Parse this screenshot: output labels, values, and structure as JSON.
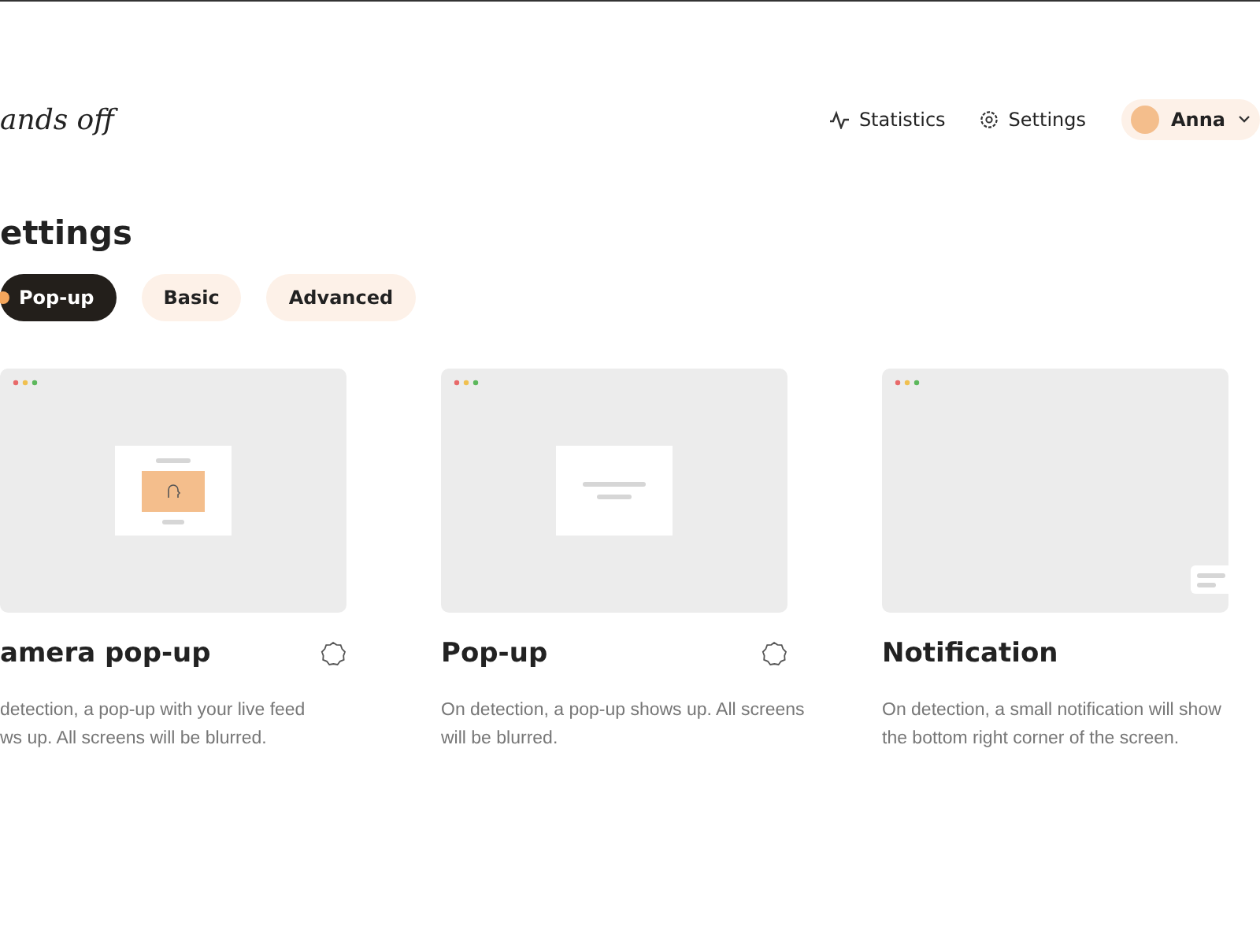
{
  "header": {
    "logo": "ands off",
    "nav": [
      {
        "kind": "statistics",
        "label": "Statistics"
      },
      {
        "kind": "settings",
        "label": "Settings"
      }
    ],
    "user": {
      "name": "Anna"
    }
  },
  "title": "ettings",
  "tabs": [
    {
      "label": "Pop-up",
      "selected": true
    },
    {
      "label": "Basic",
      "selected": false
    },
    {
      "label": "Advanced",
      "selected": false
    }
  ],
  "cards": [
    {
      "kind": "camera",
      "title": "amera pop-up",
      "selected": false,
      "description": [
        "detection, a pop-up with your live feed",
        "ws up. All screens will be blurred."
      ]
    },
    {
      "kind": "popup",
      "title": "Pop-up",
      "selected": false,
      "description": [
        "On detection, a pop-up shows up. All screens",
        "will be blurred."
      ]
    },
    {
      "kind": "notification",
      "title": "Notification",
      "description": [
        "On detection, a small notification will show",
        "the bottom right corner of the screen."
      ]
    }
  ]
}
